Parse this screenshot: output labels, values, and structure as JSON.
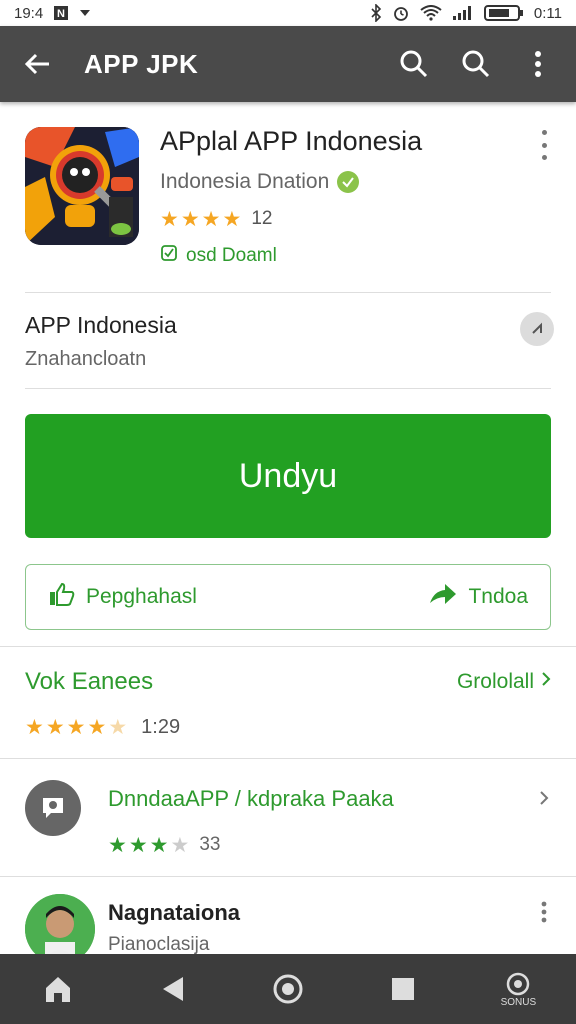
{
  "status_bar": {
    "time_left": "19:4",
    "time_right": "0:11"
  },
  "app_bar": {
    "title": "APP JPK",
    "icons": [
      "back-arrow-icon",
      "search-icon",
      "search-icon",
      "more-vert-icon"
    ]
  },
  "app": {
    "name": "APplal APP Indonesia",
    "developer": "Indonesia Dnation",
    "rating_stars": 4,
    "rating_count": "12",
    "installed_label": "osd Doaml"
  },
  "info": {
    "title": "APP Indonesia",
    "subtitle": "Znahancloatn"
  },
  "install_button": {
    "label": "Undyu"
  },
  "actions": {
    "left_label": "Pepghahasl",
    "right_label": "Tndoa"
  },
  "reviews": {
    "title": "Vok Eanees",
    "link_label": "Grololall",
    "rating_stars": 4.5,
    "count": "1:29"
  },
  "list": [
    {
      "title": "DnndaaAPP / kdpraka Paaka",
      "stars": 3,
      "count": "33"
    },
    {
      "title": "Nagnataiona",
      "subtitle": "Pianoclasija"
    }
  ],
  "nav": {
    "home_label": "",
    "right_label": "SONUS"
  },
  "colors": {
    "app_bar": "#4a4a4a",
    "accent_green": "#22a022",
    "text_green": "#2e9a2e",
    "star_orange": "#f5a623",
    "nav_bar": "#3c3c3c"
  }
}
